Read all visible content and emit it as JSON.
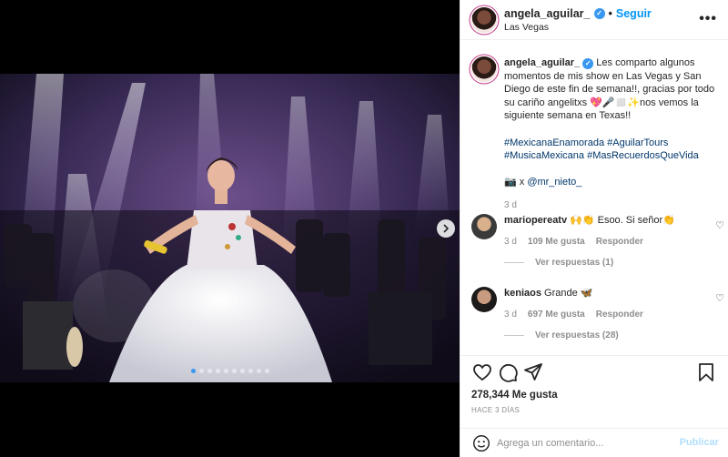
{
  "post": {
    "username": "angela_aguilar_",
    "follow_label": "Seguir",
    "separator": "•",
    "location": "Las Vegas",
    "more_label": "•••"
  },
  "caption": {
    "username": "angela_aguilar_",
    "text": "Les comparto algunos momentos de mis show en Las Vegas y San Diego de este fin de semana!!, gracias por todo su cariño angelitxs 💖🎤◻️✨nos vemos la siguiente semana en Texas!!",
    "hashtags_line1": "#MexicanaEnamorada #AguilarTours",
    "hashtags_line2": "#MusicaMexicana #MasRecuerdosQueVida",
    "credit_prefix": "📷 x ",
    "credit_mention": "@mr_nieto_",
    "time": "3 d"
  },
  "comments": [
    {
      "username": "mariopereatv",
      "text": "🙌👏 Esoo. Si señor👏",
      "time": "3 d",
      "likes": "109 Me gusta",
      "reply_label": "Responder",
      "view_replies": "Ver respuestas (1)"
    },
    {
      "username": "keniaos",
      "text": "Grande 🦋",
      "time": "3 d",
      "likes": "697 Me gusta",
      "reply_label": "Responder",
      "view_replies": "Ver respuestas (28)"
    }
  ],
  "stats": {
    "likes": "278,344 Me gusta",
    "date": "HACE 3 DÍAS"
  },
  "composer": {
    "placeholder": "Agrega un comentario...",
    "post_label": "Publicar"
  },
  "carousel": {
    "total": 10,
    "active_index": 0
  },
  "colors": {
    "accent": "#0095f6",
    "verified": "#3897f0",
    "muted": "#8e8e8e"
  },
  "icons": [
    "verified-badge-icon",
    "more-options-icon",
    "like-heart-icon",
    "comment-icon",
    "share-icon",
    "save-bookmark-icon",
    "emoji-icon",
    "carousel-next-icon",
    "comment-like-icon"
  ]
}
